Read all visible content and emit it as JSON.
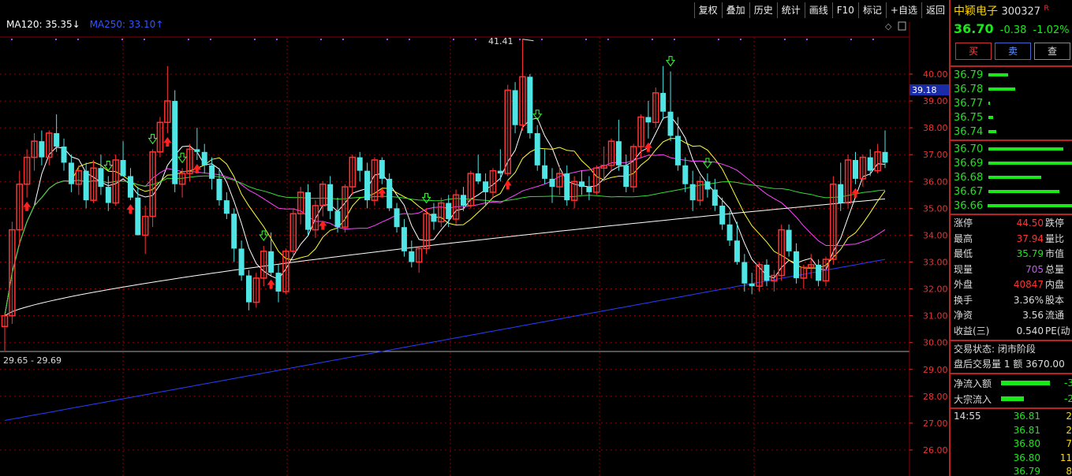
{
  "toolbar": {
    "buttons": [
      "复权",
      "叠加",
      "历史",
      "统计",
      "画线",
      "F10",
      "标记",
      "+自选",
      "返回"
    ]
  },
  "legend": {
    "ma120": "MA120: 35.35↓",
    "ma250": "MA250: 33.10↑"
  },
  "annotations": {
    "peak": "41.41",
    "low_range": "29.65 - 29.69",
    "current_price_tag": "39.18"
  },
  "y_axis": {
    "labels": [
      "40.00",
      "39.00",
      "38.00",
      "37.00",
      "36.00",
      "35.00",
      "34.00",
      "33.00",
      "32.00",
      "31.00",
      "30.00",
      "29.00",
      "28.00",
      "27.00",
      "26.00"
    ]
  },
  "symbol": {
    "name": "中颖电子",
    "code": "300327",
    "flag": "R",
    "price": "36.70",
    "change": "-0.38",
    "pct": "-1.02%"
  },
  "trade_buttons": {
    "buy": "买",
    "sell": "卖",
    "query": "查"
  },
  "order_book": {
    "asks": [
      {
        "price": "36.79",
        "bar": 0.22
      },
      {
        "price": "36.78",
        "bar": 0.3
      },
      {
        "price": "36.77",
        "bar": 0.02
      },
      {
        "price": "36.75",
        "bar": 0.05
      },
      {
        "price": "36.74",
        "bar": 0.09
      }
    ],
    "bids": [
      {
        "price": "36.70",
        "bar": 0.85
      },
      {
        "price": "36.69",
        "bar": 0.95
      },
      {
        "price": "36.68",
        "bar": 0.6
      },
      {
        "price": "36.67",
        "bar": 0.8
      },
      {
        "price": "36.66",
        "bar": 1.0
      }
    ]
  },
  "stats": [
    {
      "label": "涨停",
      "value": "44.50",
      "label2": "跌停",
      "color": "red"
    },
    {
      "label": "最高",
      "value": "37.94",
      "label2": "量比",
      "color": "red"
    },
    {
      "label": "最低",
      "value": "35.79",
      "label2": "市值",
      "color": "green"
    },
    {
      "label": "现量",
      "value": "705",
      "label2": "总量",
      "color": "purple"
    },
    {
      "label": "外盘",
      "value": "40847",
      "label2": "内盘",
      "color": "red"
    },
    {
      "label": "换手",
      "value": "3.36%",
      "label2": "股本",
      "color": "white"
    },
    {
      "label": "净资",
      "value": "3.56",
      "label2": "流通",
      "color": "white"
    },
    {
      "label": "收益(三)",
      "value": "0.540",
      "label2": "PE(动",
      "color": "white"
    }
  ],
  "trading_status": "交易状态: 闭市阶段",
  "after_hours": "盘后交易量 1 额 3670.00",
  "flows": [
    {
      "label": "净流入额",
      "bar": 0.78,
      "value": "-3"
    },
    {
      "label": "大宗流入",
      "bar": 0.36,
      "value": "-2"
    }
  ],
  "ticks": [
    {
      "time": "14:55",
      "price": "36.81",
      "vol": "2"
    },
    {
      "time": "",
      "price": "36.81",
      "vol": "2"
    },
    {
      "time": "",
      "price": "36.80",
      "vol": "7"
    },
    {
      "time": "",
      "price": "36.80",
      "vol": "11"
    },
    {
      "time": "",
      "price": "36.79",
      "vol": "8"
    }
  ],
  "colors": {
    "up": "#ff3333",
    "down": "#4fe5e5",
    "ma5": "#ffffff",
    "ma10": "#ffff33",
    "ma20": "#ff44ff",
    "ma60": "#33ff33",
    "ma120": "#ffffff",
    "ma250": "#2b3dff",
    "grid": "#8b0000"
  }
}
